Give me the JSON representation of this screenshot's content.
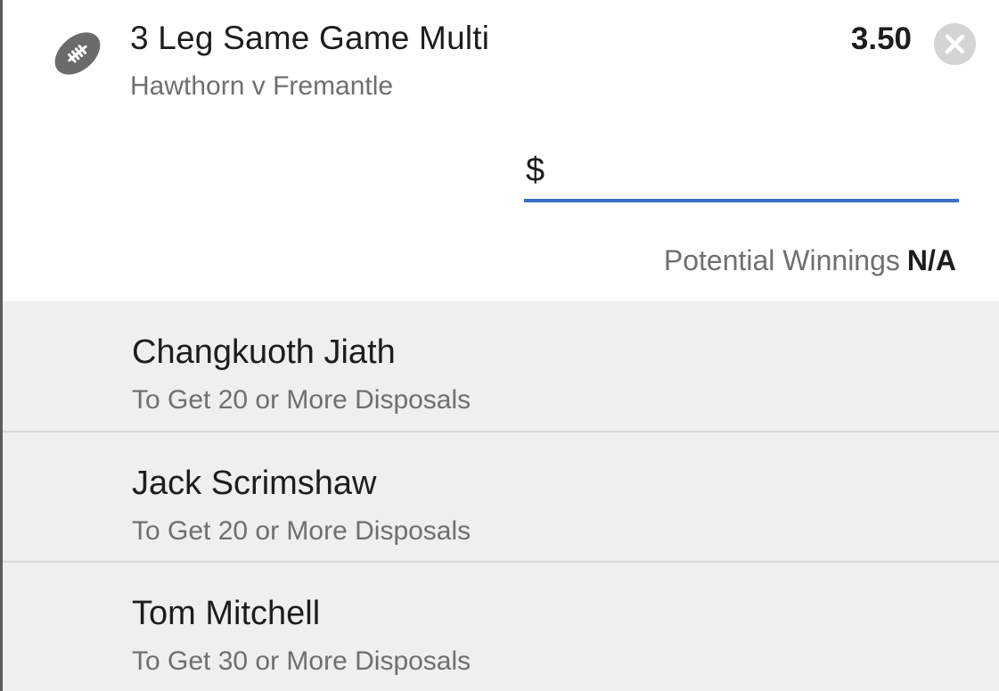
{
  "bet": {
    "title": "3 Leg Same Game Multi",
    "match": "Hawthorn v Fremantle",
    "odds": "3.50",
    "icon": "football-icon",
    "close_icon": "close-icon"
  },
  "stake": {
    "currency": "$",
    "value": "",
    "placeholder": ""
  },
  "winnings": {
    "label": "Potential Winnings",
    "value": "N/A"
  },
  "legs": [
    {
      "player": "Changkuoth Jiath",
      "market": "To Get 20 or More Disposals"
    },
    {
      "player": "Jack Scrimshaw",
      "market": "To Get 20 or More Disposals"
    },
    {
      "player": "Tom Mitchell",
      "market": "To Get 30 or More Disposals"
    }
  ],
  "colors": {
    "accent_underline": "#3a6fc4",
    "icon_grey": "#6b6b6b",
    "list_background": "#efefef"
  }
}
